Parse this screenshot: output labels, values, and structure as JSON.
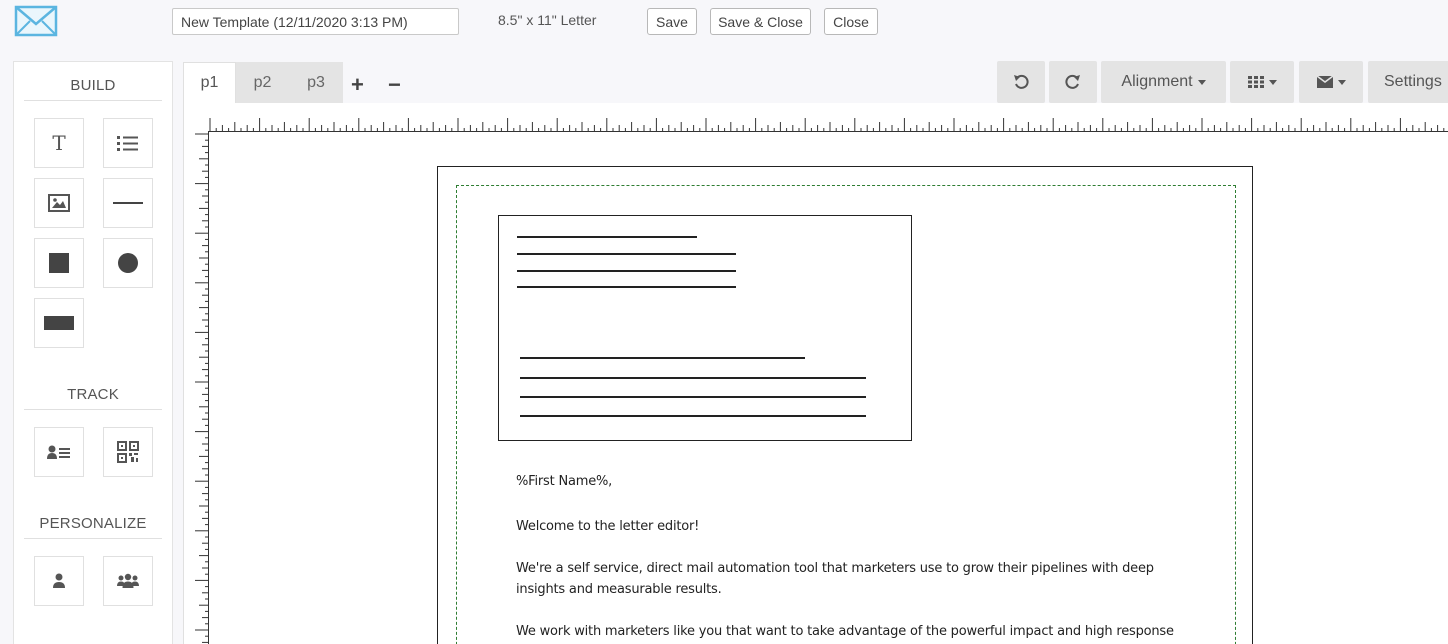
{
  "header": {
    "template_name": "New Template (12/11/2020 3:13 PM)",
    "paper_size": "8.5\" x 11\" Letter",
    "save_label": "Save",
    "save_close_label": "Save & Close",
    "close_label": "Close"
  },
  "sidebar": {
    "build_label": "BUILD",
    "track_label": "TRACK",
    "personalize_label": "PERSONALIZE"
  },
  "tabs": [
    {
      "label": "p1"
    },
    {
      "label": "p2"
    },
    {
      "label": "p3"
    }
  ],
  "page_controls": {
    "add": "+",
    "remove": "−"
  },
  "toolbar": {
    "alignment_label": "Alignment",
    "settings_label": "Settings"
  },
  "letter": {
    "greeting": "%First Name%,",
    "line1": "Welcome to the letter editor!",
    "line2": "We're a self service, direct mail automation tool that marketers use to grow their pipelines with deep insights and measurable results.",
    "line3": "We work with marketers like you that want to take advantage of the powerful impact and high response rates"
  },
  "colors": {
    "logo_blue": "#5bb5e0",
    "guide_green": "#2e7d32",
    "toolbar_gray": "#e4e4e4"
  }
}
